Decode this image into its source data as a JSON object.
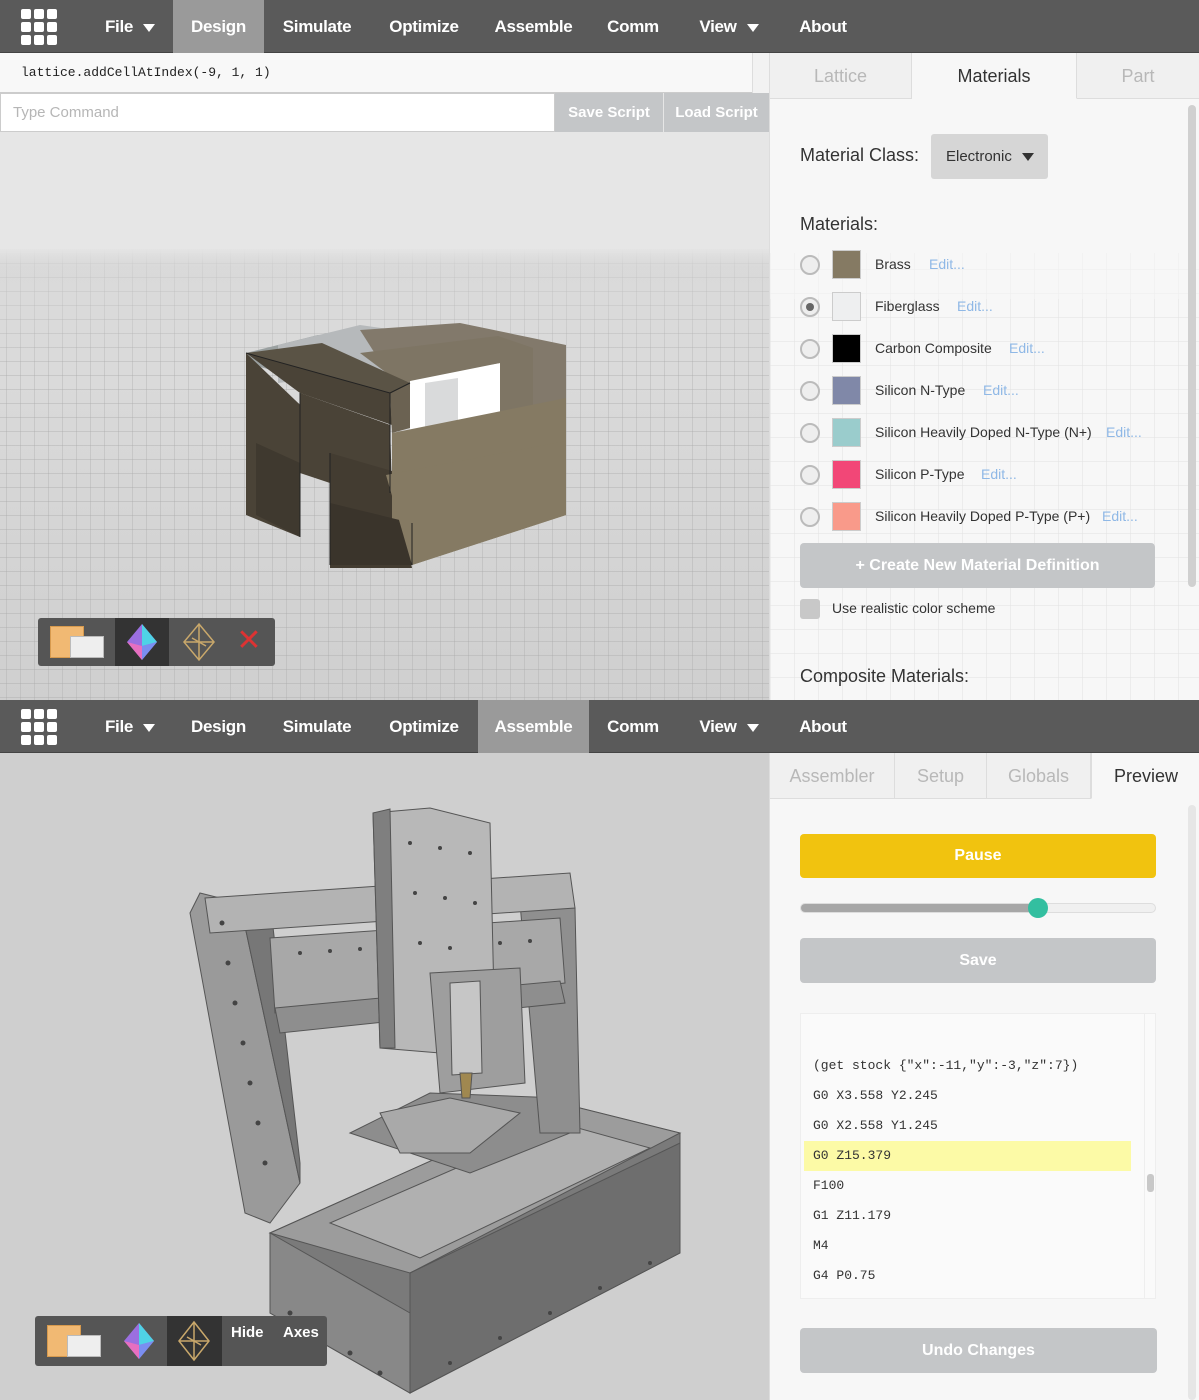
{
  "top": {
    "nav": {
      "file": "File",
      "design": "Design",
      "simulate": "Simulate",
      "optimize": "Optimize",
      "assemble": "Assemble",
      "comm": "Comm",
      "view": "View",
      "about": "About",
      "active": "Design"
    },
    "console": {
      "script_text": "lattice.addCellAtIndex(-9, 1, 1)",
      "command_placeholder": "Type Command",
      "save_script": "Save Script",
      "load_script": "Load Script"
    },
    "tabs": [
      "Lattice",
      "Materials",
      "Part"
    ],
    "active_tab": "Materials",
    "material_class_label": "Material Class:",
    "material_class_value": "Electronic",
    "materials_heading": "Materials:",
    "materials": [
      {
        "name": "Brass",
        "color": "#857a63",
        "edit": "Edit...",
        "checked": false
      },
      {
        "name": "Fiberglass",
        "color": "#eeeff0",
        "edit": "Edit...",
        "checked": true
      },
      {
        "name": "Carbon Composite",
        "color": "#000000",
        "edit": "Edit...",
        "checked": false
      },
      {
        "name": "Silicon N-Type",
        "color": "#8088a8",
        "edit": "Edit...",
        "checked": false
      },
      {
        "name": "Silicon Heavily Doped N-Type (N+)",
        "color": "#9acccc",
        "edit": "Edit...",
        "checked": false
      },
      {
        "name": "Silicon P-Type",
        "color": "#f24777",
        "edit": "Edit...",
        "checked": false
      },
      {
        "name": "Silicon Heavily Doped P-Type (P+)",
        "color": "#f99a8a",
        "edit": "Edit...",
        "checked": false
      }
    ],
    "create_button": "+ Create New Material Definition",
    "realistic_label": "Use realistic color scheme",
    "composite_heading": "Composite Materials:",
    "toolbar_icons": [
      "voxel-box-icon",
      "octahedron-icon",
      "wireframe-octahedron-icon",
      "close-icon"
    ]
  },
  "bottom": {
    "nav": {
      "file": "File",
      "design": "Design",
      "simulate": "Simulate",
      "optimize": "Optimize",
      "assemble": "Assemble",
      "comm": "Comm",
      "view": "View",
      "about": "About",
      "active": "Assemble"
    },
    "tabs": [
      "Assembler",
      "Setup",
      "Globals",
      "Preview"
    ],
    "active_tab": "Preview",
    "pause_button": "Pause",
    "playback_progress": 0.67,
    "save_button": "Save",
    "gcode_lines": [
      "(get stock {\"x\":-11,\"y\":-3,\"z\":7})",
      "G0 X3.558 Y2.245",
      "G0 X2.558 Y1.245",
      "G0 Z15.379",
      "F100",
      "G1 Z11.179",
      "M4",
      "G4 P0.75"
    ],
    "highlighted_line": 3,
    "undo_button": "Undo Changes",
    "toolbar_hide": "Hide",
    "toolbar_axes": "Axes",
    "colors": {
      "pause": "#f1c30f",
      "slider_knob": "#33bfa0",
      "highlight": "#fcfaa6"
    }
  }
}
